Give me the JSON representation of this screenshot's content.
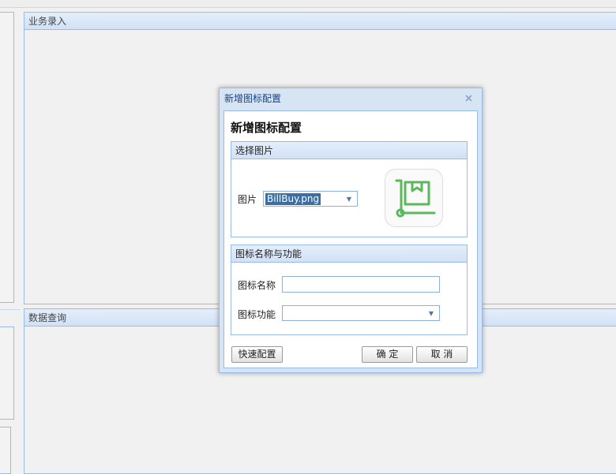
{
  "panels": {
    "entry_title": "业务录入",
    "query_title": "数据查询"
  },
  "dialog": {
    "window_title": "新增图标配置",
    "form_title": "新增图标配置",
    "close_icon": "close-icon",
    "image_section": {
      "title": "选择图片",
      "image_label": "图片",
      "image_value": "BillBuy.png",
      "preview_icon": "cart-box-icon",
      "preview_color": "#5cb85c"
    },
    "name_section": {
      "title": "图标名称与功能",
      "name_label": "图标名称",
      "name_value": "",
      "function_label": "图标功能",
      "function_value": ""
    },
    "buttons": {
      "quick_config": "快速配置",
      "ok": "确 定",
      "cancel": "取 消"
    }
  }
}
